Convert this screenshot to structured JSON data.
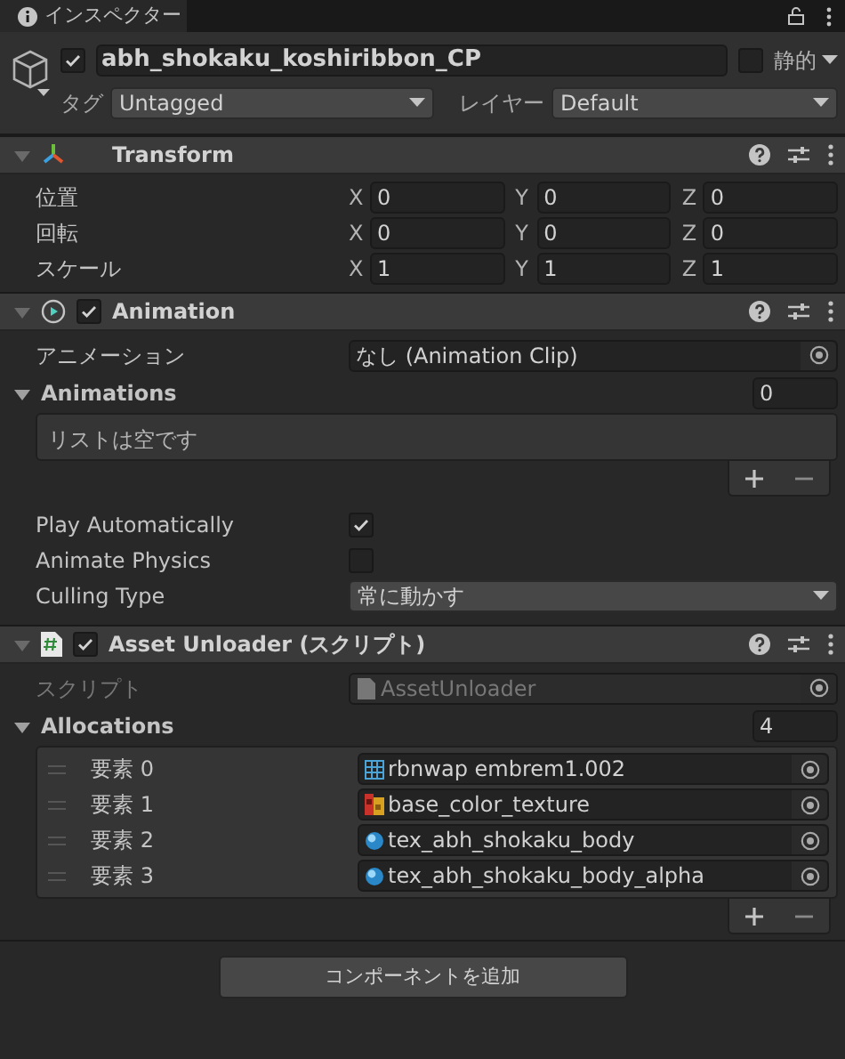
{
  "tab": {
    "title": "インスペクター"
  },
  "object": {
    "active": true,
    "name": "abh_shokaku_koshiribbon_CP",
    "static": false,
    "static_label": "静的",
    "tag_label": "タグ",
    "tag": "Untagged",
    "layer_label": "レイヤー",
    "layer": "Default"
  },
  "components": [
    {
      "kind": "transform",
      "title": "Transform",
      "expanded": true,
      "rows": [
        {
          "label": "位置",
          "fields": [
            {
              "axis": "X",
              "value": "0"
            },
            {
              "axis": "Y",
              "value": "0"
            },
            {
              "axis": "Z",
              "value": "0"
            }
          ]
        },
        {
          "label": "回転",
          "fields": [
            {
              "axis": "X",
              "value": "0"
            },
            {
              "axis": "Y",
              "value": "0"
            },
            {
              "axis": "Z",
              "value": "0"
            }
          ]
        },
        {
          "label": "スケール",
          "fields": [
            {
              "axis": "X",
              "value": "1"
            },
            {
              "axis": "Y",
              "value": "1"
            },
            {
              "axis": "Z",
              "value": "1"
            }
          ]
        }
      ]
    },
    {
      "kind": "animation",
      "title": "Animation",
      "expanded": true,
      "enabled": true,
      "field": {
        "label": "アニメーション",
        "value": "なし (Animation Clip)",
        "disabled": false
      },
      "list": {
        "title": "Animations",
        "count": "0",
        "expanded": true,
        "empty_text": "リストは空です"
      },
      "props": [
        {
          "kind": "checkbox",
          "label": "Play Automatically",
          "checked": true
        },
        {
          "kind": "checkbox",
          "label": "Animate Physics",
          "checked": false
        },
        {
          "kind": "dropdown",
          "label": "Culling Type",
          "value": "常に動かす"
        }
      ]
    },
    {
      "kind": "script",
      "title": "Asset Unloader (スクリプト)",
      "expanded": true,
      "enabled": true,
      "field": {
        "label": "スクリプト",
        "value": "AssetUnloader",
        "disabled": true
      },
      "list": {
        "title": "Allocations",
        "count": "4",
        "expanded": true,
        "items": [
          {
            "label": "要素 0",
            "kind": "mesh",
            "value": "rbnwap embrem1.002"
          },
          {
            "label": "要素 1",
            "kind": "texture",
            "value": "base_color_texture"
          },
          {
            "label": "要素 2",
            "kind": "material",
            "value": "tex_abh_shokaku_body"
          },
          {
            "label": "要素 3",
            "kind": "material",
            "value": "tex_abh_shokaku_body_alpha"
          }
        ]
      }
    }
  ],
  "add_component_button": "コンポーネントを追加"
}
